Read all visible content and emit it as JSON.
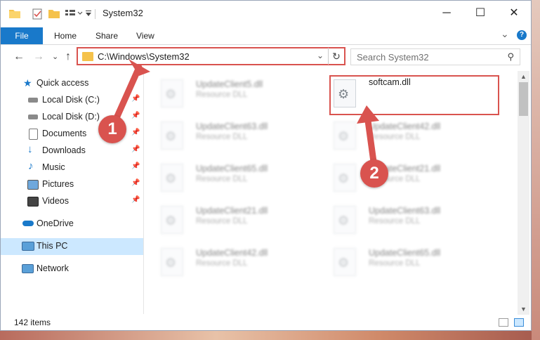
{
  "window": {
    "title": "System32",
    "controls": {
      "minimize": "─",
      "maximize": "☐",
      "close": "✕"
    }
  },
  "ribbon": {
    "tabs": [
      {
        "label": "File"
      },
      {
        "label": "Home"
      },
      {
        "label": "Share"
      },
      {
        "label": "View"
      }
    ],
    "expand_icon": "⌄",
    "help_icon": "?"
  },
  "navigation": {
    "back": "←",
    "forward": "→",
    "recent": "⌄",
    "up": "↑",
    "address_path": "C:\\Windows\\System32",
    "address_dropdown": "⌄",
    "refresh": "↻",
    "search_placeholder": "Search System32",
    "search_icon": "⚲"
  },
  "sidebar": {
    "quick_access": "Quick access",
    "items": [
      {
        "label": "Local Disk (C:)",
        "icon": "drive-icon",
        "pinned": true
      },
      {
        "label": "Local Disk (D:)",
        "icon": "drive-icon",
        "pinned": true
      },
      {
        "label": "Documents",
        "icon": "documents-icon",
        "pinned": true
      },
      {
        "label": "Downloads",
        "icon": "downloads-icon",
        "pinned": true
      },
      {
        "label": "Music",
        "icon": "music-icon",
        "pinned": true
      },
      {
        "label": "Pictures",
        "icon": "pictures-icon",
        "pinned": true
      },
      {
        "label": "Videos",
        "icon": "videos-icon",
        "pinned": true
      }
    ],
    "onedrive": "OneDrive",
    "this_pc": "This PC",
    "network": "Network",
    "pin_glyph": "📌"
  },
  "files": {
    "left_column": [
      {
        "name": "UpdateClient5.dll",
        "type": "Resource DLL"
      },
      {
        "name": "UpdateClient63.dll",
        "type": "Resource DLL"
      },
      {
        "name": "UpdateClient65.dll",
        "type": "Resource DLL"
      },
      {
        "name": "UpdateClient21.dll",
        "type": "Resource DLL"
      },
      {
        "name": "UpdateClient42.dll",
        "type": "Resource DLL"
      }
    ],
    "right_column": [
      {
        "name": "softcam.dll",
        "type": ""
      },
      {
        "name": "UpdateClient42.dll",
        "type": "Resource DLL"
      },
      {
        "name": "UpdateClient21.dll",
        "type": "Resource DLL"
      },
      {
        "name": "UpdateClient63.dll",
        "type": "Resource DLL"
      },
      {
        "name": "UpdateClient65.dll",
        "type": "Resource DLL"
      }
    ]
  },
  "status": {
    "item_count": "142 items"
  },
  "annotations": {
    "badge1": "1",
    "badge2": "2",
    "color": "#d9534f"
  }
}
